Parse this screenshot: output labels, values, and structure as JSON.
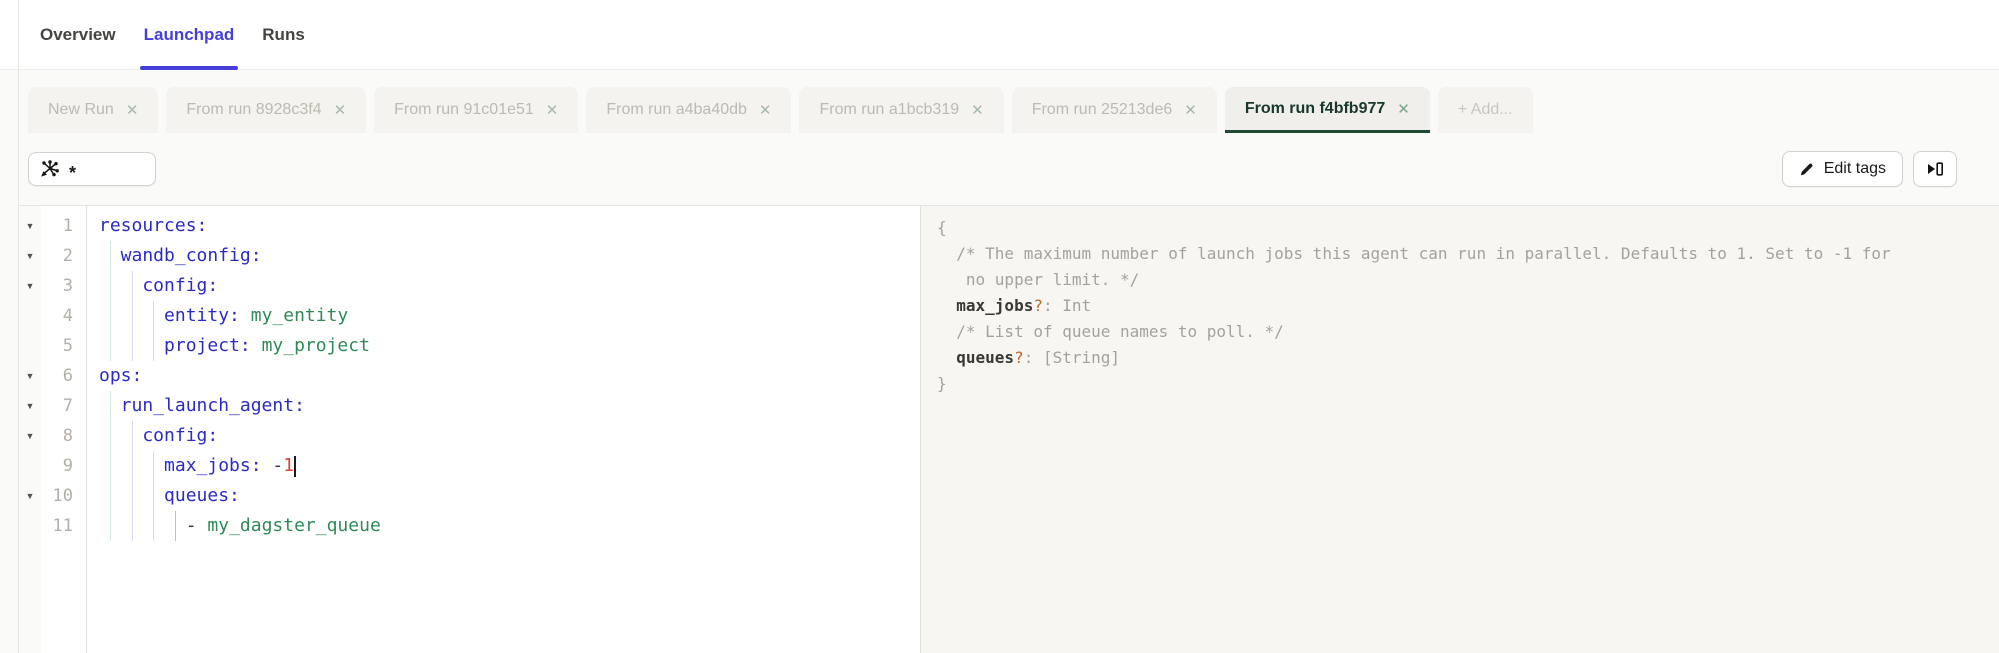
{
  "nav": {
    "tabs": [
      {
        "label": "Overview",
        "active": false
      },
      {
        "label": "Launchpad",
        "active": true
      },
      {
        "label": "Runs",
        "active": false
      }
    ]
  },
  "run_tabs": {
    "close_glyph": "✕",
    "add_label": "+ Add...",
    "tabs": [
      {
        "label": "New Run",
        "active": false
      },
      {
        "label": "From run 8928c3f4",
        "active": false
      },
      {
        "label": "From run 91c01e51",
        "active": false
      },
      {
        "label": "From run a4ba40db",
        "active": false
      },
      {
        "label": "From run a1bcb319",
        "active": false
      },
      {
        "label": "From run 25213de6",
        "active": false
      },
      {
        "label": "From run f4bfb977",
        "active": true
      }
    ]
  },
  "toolbar": {
    "selector_value": "*",
    "edit_tags_label": "Edit tags",
    "icons": {
      "selector": "graph-splat-icon",
      "edit": "pencil-icon",
      "expand": "open-panel-icon"
    }
  },
  "editor": {
    "lines": [
      {
        "num": "1",
        "fold": true,
        "guides": [],
        "tokens": [
          {
            "t": "resources:",
            "c": "k"
          }
        ]
      },
      {
        "num": "2",
        "fold": true,
        "guides": [
          {
            "col": 1,
            "c": "gr"
          }
        ],
        "tokens": [
          {
            "t": "  wandb_config:",
            "c": "k"
          }
        ]
      },
      {
        "num": "3",
        "fold": true,
        "guides": [
          {
            "col": 1,
            "c": "gr"
          },
          {
            "col": 3,
            "c": "pl"
          }
        ],
        "tokens": [
          {
            "t": "    config:",
            "c": "k"
          }
        ]
      },
      {
        "num": "4",
        "fold": false,
        "guides": [
          {
            "col": 1,
            "c": "gr"
          },
          {
            "col": 3,
            "c": "pl"
          },
          {
            "col": 5,
            "c": "pl"
          }
        ],
        "tokens": [
          {
            "t": "      entity:",
            "c": "k"
          },
          {
            "t": " ",
            "c": "o"
          },
          {
            "t": "my_entity",
            "c": "v"
          }
        ]
      },
      {
        "num": "5",
        "fold": false,
        "guides": [
          {
            "col": 1,
            "c": "gr"
          },
          {
            "col": 3,
            "c": "pl"
          },
          {
            "col": 5,
            "c": "pl"
          }
        ],
        "tokens": [
          {
            "t": "      project:",
            "c": "k"
          },
          {
            "t": " ",
            "c": "o"
          },
          {
            "t": "my_project",
            "c": "v"
          }
        ]
      },
      {
        "num": "6",
        "fold": true,
        "guides": [],
        "tokens": [
          {
            "t": "ops:",
            "c": "k"
          }
        ]
      },
      {
        "num": "7",
        "fold": true,
        "guides": [
          {
            "col": 1,
            "c": "gr"
          }
        ],
        "tokens": [
          {
            "t": "  run_launch_agent:",
            "c": "k"
          }
        ]
      },
      {
        "num": "8",
        "fold": true,
        "guides": [
          {
            "col": 1,
            "c": "gr"
          },
          {
            "col": 3,
            "c": "pl"
          }
        ],
        "tokens": [
          {
            "t": "    config:",
            "c": "k"
          }
        ]
      },
      {
        "num": "9",
        "fold": false,
        "guides": [
          {
            "col": 1,
            "c": "gr"
          },
          {
            "col": 3,
            "c": "pl"
          },
          {
            "col": 5,
            "c": "pl"
          }
        ],
        "tokens": [
          {
            "t": "      max_jobs:",
            "c": "k"
          },
          {
            "t": " ",
            "c": "o"
          },
          {
            "t": "-",
            "c": "o"
          },
          {
            "t": "1",
            "c": "n"
          },
          {
            "cursor": true
          }
        ]
      },
      {
        "num": "10",
        "fold": true,
        "guides": [
          {
            "col": 1,
            "c": "gr"
          },
          {
            "col": 3,
            "c": "pl"
          },
          {
            "col": 5,
            "c": "pl"
          }
        ],
        "tokens": [
          {
            "t": "      queues:",
            "c": "k"
          }
        ]
      },
      {
        "num": "11",
        "fold": false,
        "guides": [
          {
            "col": 1,
            "c": "gr"
          },
          {
            "col": 3,
            "c": "pl"
          },
          {
            "col": 5,
            "c": "pl"
          },
          {
            "col": 7,
            "c": "rd"
          }
        ],
        "tokens": [
          {
            "t": "        ",
            "c": "o"
          },
          {
            "t": "-",
            "c": "o"
          },
          {
            "t": " ",
            "c": "o"
          },
          {
            "t": "my_dagster_queue",
            "c": "v"
          }
        ]
      }
    ]
  },
  "schema": {
    "lines": [
      [
        {
          "t": "{",
          "c": "p"
        }
      ],
      [
        {
          "t": "  /* The maximum number of launch jobs this agent can run in parallel. Defaults to 1. Set to -1 for",
          "c": "p"
        }
      ],
      [
        {
          "t": "   no upper limit. */",
          "c": "p"
        }
      ],
      [
        {
          "t": "  ",
          "c": "p"
        },
        {
          "t": "max_jobs",
          "c": "prop"
        },
        {
          "t": "?",
          "c": "q"
        },
        {
          "t": ": ",
          "c": "p"
        },
        {
          "t": "Int",
          "c": "p"
        }
      ],
      [
        {
          "t": "  /* List of queue names to poll. */",
          "c": "p"
        }
      ],
      [
        {
          "t": "  ",
          "c": "p"
        },
        {
          "t": "queues",
          "c": "prop"
        },
        {
          "t": "?",
          "c": "q"
        },
        {
          "t": ": ",
          "c": "p"
        },
        {
          "t": "[String]",
          "c": "p"
        }
      ],
      [
        {
          "t": "}",
          "c": "p"
        }
      ]
    ]
  },
  "colors": {
    "nav_active": "#473fd9",
    "selected_tab_green": "#1d4b34",
    "yaml_key_blue": "#2b2bc4",
    "yaml_value_green": "#2f8a58",
    "yaml_number_red": "#d9443f",
    "schema_optional_orange": "#c06524"
  }
}
